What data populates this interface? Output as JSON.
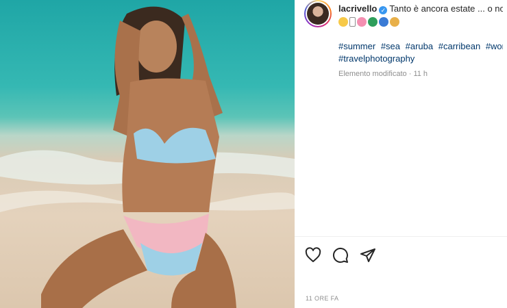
{
  "post": {
    "username": "lacrivello",
    "caption_start": "Tanto è ancora estate ... o no",
    "emoji_icons": [
      "sunglasses-face-icon",
      "sun-icon",
      "hibiscus-icon",
      "globe-icon",
      "wave-icon",
      "hand-icon"
    ],
    "hashtags": [
      "#summer",
      "#sea",
      "#aruba",
      "#carribean",
      "#worldtravelpic",
      "#travelphotography"
    ],
    "edited_label": "Elemento modificato",
    "edited_time": "11 h",
    "timestamp": "11 ORE FA"
  },
  "actions": {
    "like": "heart-icon",
    "comment": "comment-bubble-icon",
    "share": "paper-plane-icon"
  },
  "colors": {
    "hashtag": "#00376b",
    "verified": "#3897f0",
    "muted": "#8e8e8e"
  }
}
